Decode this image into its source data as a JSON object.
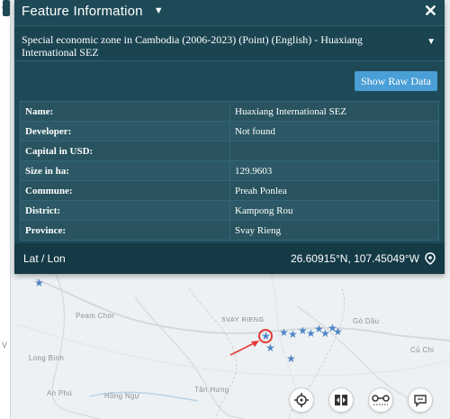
{
  "panel": {
    "title": "Feature Information",
    "close_glyph": "✕",
    "layer_name": "Special economic zone in Cambodia (2006-2023) (Point) (English) - Huaxiang International SEZ",
    "raw_button": "Show Raw Data",
    "attributes": [
      {
        "key": "Name:",
        "value": "Huaxiang International SEZ"
      },
      {
        "key": "Developer:",
        "value": "Not found"
      },
      {
        "key": "Capital in USD:",
        "value": ""
      },
      {
        "key": "Size in ha:",
        "value": "129.9603"
      },
      {
        "key": "Commune:",
        "value": "Preah Ponlea"
      },
      {
        "key": "District:",
        "value": "Kampong Rou"
      },
      {
        "key": "Province:",
        "value": "Svay Rieng"
      }
    ],
    "latlon_label": "Lat / Lon",
    "latlon_value": "26.60915°N, 107.45049°W"
  },
  "map": {
    "labels": {
      "peam_chor": "Peam Chor",
      "svay_rieng": "SVAY RIENG",
      "go_dau": "Gò Dầu",
      "long_binh": "Long Bình",
      "cu_chi": "Củ Chi",
      "an_phu": "An Phú",
      "hong_ngu": "Hồng Ngự",
      "tan_hung": "Tân Hưng",
      "x_mark": "v",
      "x_mark2": "V"
    },
    "marker_color": "#4f86c6",
    "highlight_color": "#e53935"
  },
  "tools": {
    "locate": "crosshair-icon",
    "compare": "split-view-icon",
    "measure": "measure-icon",
    "feedback": "chat-icon"
  },
  "colors": {
    "panel_bg": "#1e4a57",
    "accent": "#4a9fd6"
  }
}
